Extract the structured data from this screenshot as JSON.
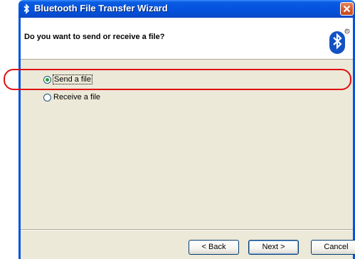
{
  "window": {
    "title": "Bluetooth File Transfer Wizard"
  },
  "header": {
    "question": "Do you want to send or receive a file?",
    "logo_icon": "bluetooth-icon"
  },
  "options": [
    {
      "label": "Send a file",
      "selected": true
    },
    {
      "label": "Receive a file",
      "selected": false
    }
  ],
  "buttons": {
    "back": "< Back",
    "next": "Next >",
    "cancel": "Cancel"
  },
  "colors": {
    "titlebar": "#0553e0",
    "highlight": "#e01010",
    "radio_dot": "#21a121"
  }
}
